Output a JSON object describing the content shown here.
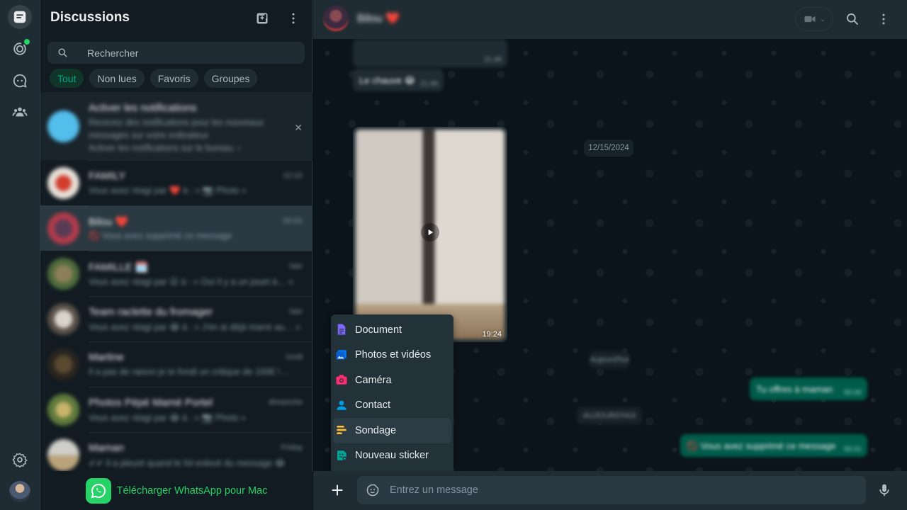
{
  "colors": {
    "accent": "#00a884",
    "brand_green": "#25d366",
    "panel": "#202c33",
    "background": "#111b21"
  },
  "rail": {
    "icons": [
      "chats-icon",
      "status-icon",
      "channels-icon",
      "communities-icon",
      "settings-icon"
    ]
  },
  "list": {
    "title": "Discussions",
    "search_placeholder": "Rechercher",
    "filters": [
      "Tout",
      "Non lues",
      "Favoris",
      "Groupes"
    ],
    "active_filter": "Tout",
    "notification": {
      "title": "Activer les notifications",
      "line1": "Recevez des notifications pour les nouveaux",
      "line2": "messages sur votre ordinateur.",
      "line3": "Activer les notifications sur le bureau. ›"
    },
    "chats": [
      {
        "name": "FAMILY",
        "preview": "Vous avez réagi par ❤️ à : « 📷 Photo »",
        "time": "12:10"
      },
      {
        "name": "Bilou ❤️",
        "preview": "🚫 Vous avez supprimé ce message",
        "time": "00:01"
      },
      {
        "name": "FAMILLE 🗓️",
        "preview": "Vous avez réagi par 😮 à : « Ouï il y a un jouet à… »",
        "time": "hier"
      },
      {
        "name": "Team raclette du fromager",
        "preview": "Vous avez réagi par 😂 à : « J'en ai déjà marre au… »",
        "time": "hier"
      },
      {
        "name": "Martine",
        "preview": "Il a pas de raison je te fondi un critique de 100€ !…",
        "time": "lundi"
      },
      {
        "name": "Photos Pépé Mamé Portel",
        "preview": "Vous avez réagi par 😂 à : « 📷 Photo »",
        "time": "dimanche"
      },
      {
        "name": "Maman",
        "preview": "✔✔ Il a pleuré quand le fol enlevé du message 😂",
        "time": "Friday"
      }
    ],
    "download_label": "Télécharger WhatsApp pour Mac"
  },
  "chat": {
    "contact_name": "Bilou ❤️",
    "date_separator": "12/15/2024",
    "blurred_msgs": [
      {
        "text": "",
        "time": "21:48"
      },
      {
        "text": "Le chauve 😂",
        "time": "21:48"
      }
    ],
    "video_time": "19:24",
    "right_pills": [
      "Aujourd'hui",
      "AUJOURD'HUI"
    ],
    "outgoing": [
      {
        "text": "Tu offres à maman",
        "time": "00:00"
      },
      {
        "text": "🚫 Vous avez supprimé ce message",
        "time": "00:01"
      }
    ],
    "composer_placeholder": "Entrez un message"
  },
  "attach_menu": {
    "items": [
      {
        "label": "Document",
        "icon": "document-icon",
        "color": "#7f66ff"
      },
      {
        "label": "Photos et vidéos",
        "icon": "photos-icon",
        "color": "#007bfc"
      },
      {
        "label": "Caméra",
        "icon": "camera-icon",
        "color": "#ff2e74"
      },
      {
        "label": "Contact",
        "icon": "contact-icon",
        "color": "#009de2"
      },
      {
        "label": "Sondage",
        "icon": "poll-icon",
        "color": "#ffbc38"
      },
      {
        "label": "Nouveau sticker",
        "icon": "sticker-icon",
        "color": "#02a698"
      }
    ]
  }
}
